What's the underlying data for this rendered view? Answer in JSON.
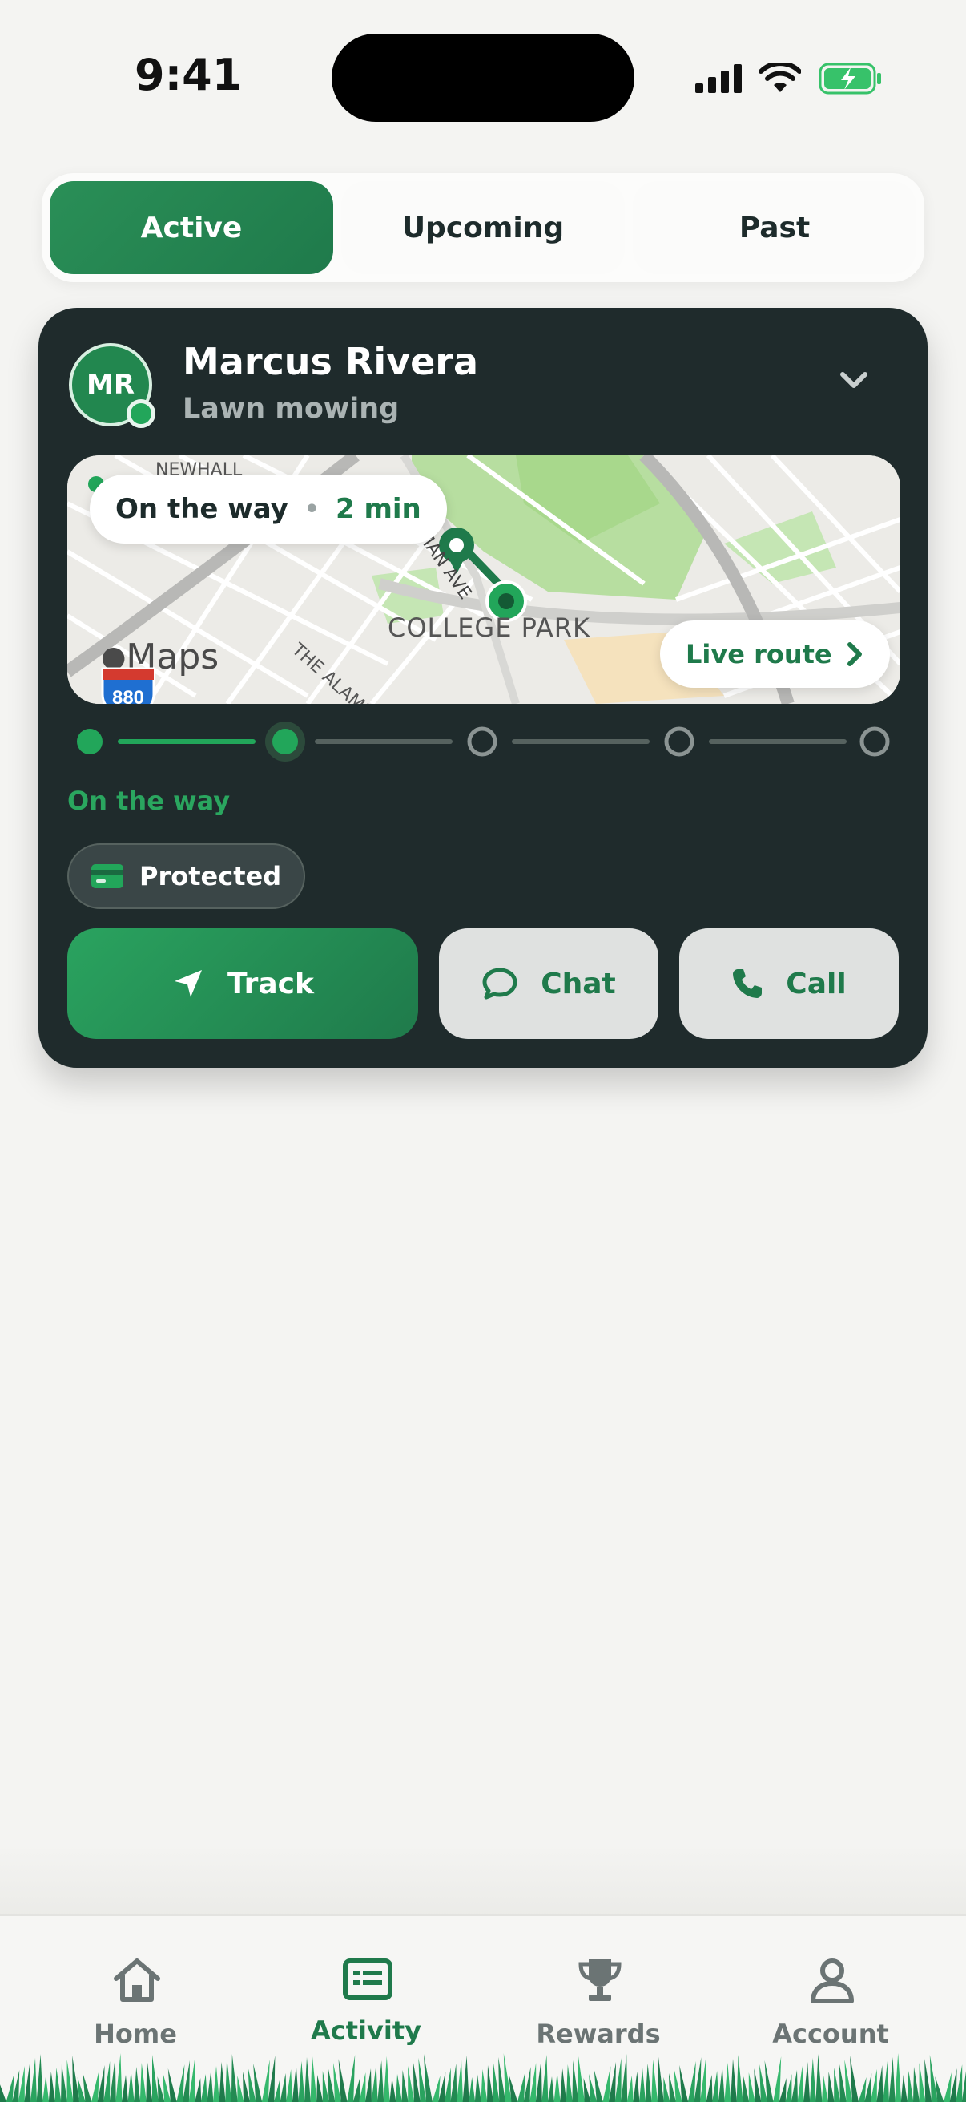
{
  "status_bar": {
    "time": "9:41"
  },
  "tabs": [
    {
      "label": "Active",
      "active": true
    },
    {
      "label": "Upcoming",
      "active": false
    },
    {
      "label": "Past",
      "active": false
    }
  ],
  "booking": {
    "avatar_initials": "MR",
    "pro_name": "Marcus Rivera",
    "service": "Lawn mowing",
    "map": {
      "eta_status": "On the way",
      "eta_separator": "•",
      "eta_time": "2 min",
      "area_label": "COLLEGE PARK",
      "street_label_1": "COLEMAN AVE",
      "street_label_2": "THE ALAMEDA",
      "street_label_3": "NEWHALL",
      "maps_brand": "Maps",
      "highway_number": "880",
      "live_route_label": "Live route"
    },
    "progress": {
      "current_step": 2,
      "total_steps": 5
    },
    "status_label": "On the way",
    "protected_label": "Protected",
    "actions": {
      "track": "Track",
      "chat": "Chat",
      "call": "Call"
    },
    "accent_color": "#1f7a4b"
  },
  "bottom_nav": [
    {
      "label": "Home",
      "icon": "home-icon",
      "active": false
    },
    {
      "label": "Activity",
      "icon": "activity-icon",
      "active": true
    },
    {
      "label": "Rewards",
      "icon": "trophy-icon",
      "active": false
    },
    {
      "label": "Account",
      "icon": "person-icon",
      "active": false
    }
  ]
}
